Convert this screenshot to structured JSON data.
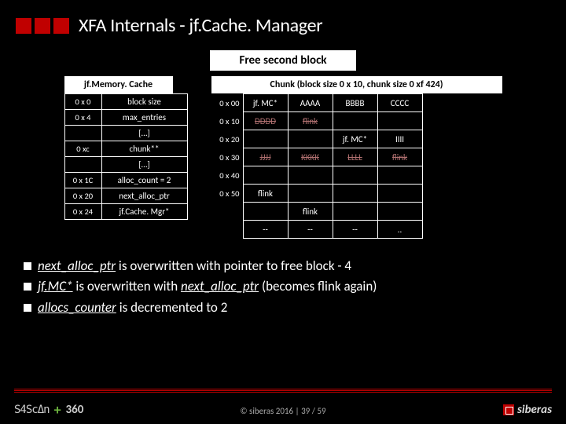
{
  "title": "XFA Internals - jf.Cache. Manager",
  "action": "Free second block",
  "mem_table": {
    "header": "jf.Memory. Cache",
    "rows": [
      {
        "addr": "0 x 0",
        "val": "block size"
      },
      {
        "addr": "0 x 4",
        "val": "max_entries"
      },
      {
        "addr": "",
        "val": "[…]"
      },
      {
        "addr": "0 xc",
        "val": "chunk**"
      },
      {
        "addr": "",
        "val": "[…]"
      },
      {
        "addr": "0 x 1C",
        "val": "alloc_count = 2"
      },
      {
        "addr": "0 x 20",
        "val": "next_alloc_ptr"
      },
      {
        "addr": "0 x 24",
        "val": "jf.Cache. Mgr*"
      }
    ]
  },
  "chunk_table": {
    "header": "Chunk (block size 0 x 10, chunk size 0 xf 424)",
    "addrs": [
      "0 x 00",
      "0 x 10",
      "0 x 20",
      "0 x 30",
      "0 x 40",
      "0 x 50",
      ""
    ],
    "cells": [
      [
        "jf. MC*",
        "AAAA",
        "BBBB",
        "CCCC"
      ],
      [
        "DDDD",
        "flink",
        "",
        ""
      ],
      [
        "",
        "",
        "jf. MC*",
        "IIII"
      ],
      [
        "JJJJ",
        "KKKK",
        "LLLL",
        "flink"
      ],
      [
        "",
        "",
        "",
        ""
      ],
      [
        "flink",
        "",
        "",
        ""
      ],
      [
        "",
        "flink",
        "",
        ""
      ],
      [
        "--",
        "--",
        "--",
        ".."
      ]
    ],
    "strike_rows": [
      1,
      3
    ]
  },
  "bullets": [
    {
      "pre": "",
      "u": "next_alloc_ptr",
      "post": " is overwritten with pointer to free block - 4"
    },
    {
      "pre": "",
      "u": "jf.MC*",
      "post": " is overwritten with ",
      "u2": "next_alloc_ptr",
      "post2": " (becomes flink again)"
    },
    {
      "pre": "",
      "u": "allocs_counter",
      "post": " is decremented to 2"
    }
  ],
  "footer": {
    "logo54": "S4ScΔn",
    "plus": "+",
    "l360": "360",
    "copy": "© siberas 2016   |   39 / 59",
    "siberas": "siberas"
  }
}
